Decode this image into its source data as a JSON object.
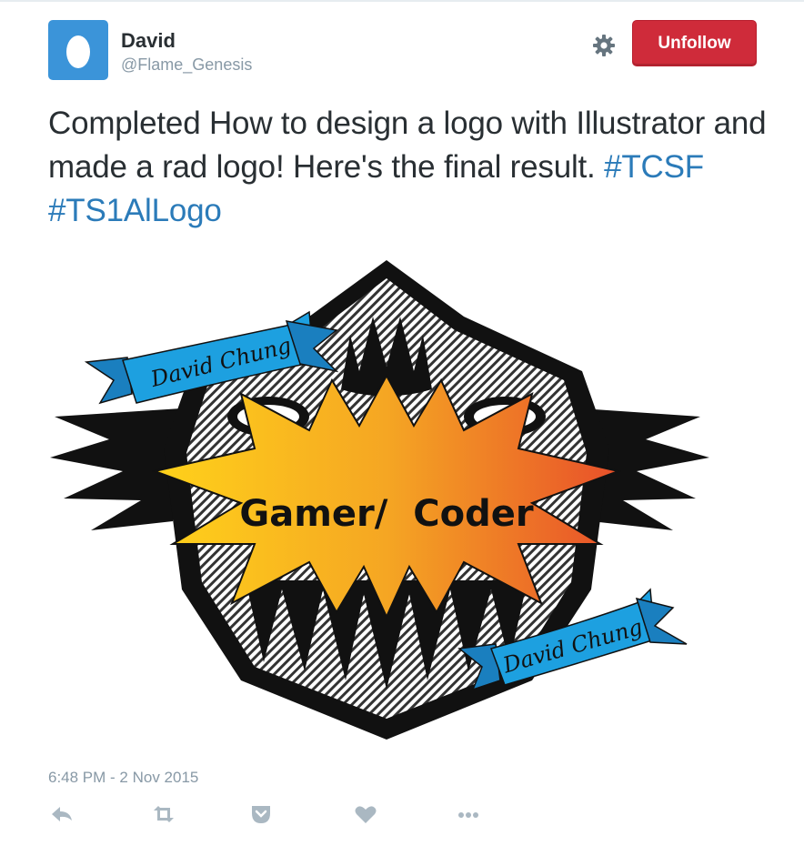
{
  "author": {
    "name": "David",
    "handle": "@Flame_Genesis",
    "avatar_icon": "egg-avatar-icon"
  },
  "header": {
    "settings_icon": "gear-icon",
    "unfollow_label": "Unfollow"
  },
  "tweet": {
    "text": "Completed How to design a logo with Illustrator and made a rad logo! Here's the final result. ",
    "hashtags": [
      "#TCSF",
      "#TS1AlLogo"
    ],
    "timestamp": "6:48 PM - 2 Nov 2015"
  },
  "media": {
    "banner_text_top": "David Chung",
    "banner_text_bottom": "David Chung",
    "center_text": "Gamer/  Coder"
  },
  "actions": [
    {
      "name": "reply",
      "icon": "reply-icon"
    },
    {
      "name": "retweet",
      "icon": "retweet-icon"
    },
    {
      "name": "save",
      "icon": "pocket-icon"
    },
    {
      "name": "like",
      "icon": "heart-icon"
    },
    {
      "name": "more",
      "icon": "more-icon"
    }
  ],
  "colors": {
    "accent": "#2b7bb9",
    "unfollow_bg": "#cf2b3a",
    "avatar_bg": "#3b94d9",
    "muted": "#8899a6",
    "ribbon": "#1da0e0"
  }
}
